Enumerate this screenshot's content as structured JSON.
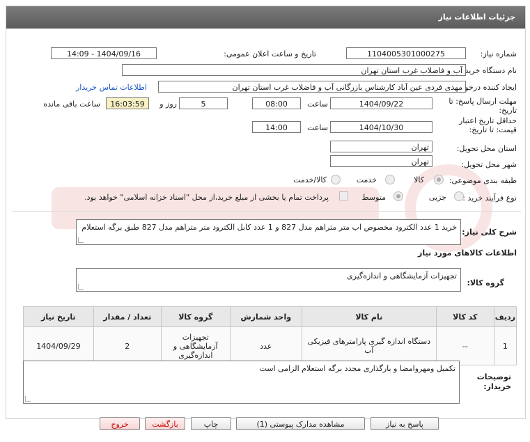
{
  "header": {
    "title": "جزئیات اطلاعات نیاز"
  },
  "fields": {
    "need_number_label": "شماره نیاز:",
    "need_number": "1104005301000275",
    "announce_label": "تاریخ و ساعت اعلان عمومی:",
    "announce_value": "1404/09/16 - 14:09",
    "buyer_org_label": "نام دستگاه خریدار:",
    "buyer_org": "آب و فاضلاب غرب استان تهران",
    "creator_label": "ایجاد کننده درخواست:",
    "creator": "مهدی فردی عین آباد کارشناس بازرگانی آب و فاضلاب غرب استان تهران",
    "contact_link": "اطلاعات تماس خریدار",
    "deadline_label_1": "مهلت ارسال پاسخ: تا",
    "deadline_label_2": "تاریخ:",
    "deadline_date": "1404/09/22",
    "time_label": "ساعت",
    "deadline_time": "08:00",
    "days_value": "5",
    "days_label": "روز و",
    "remaining_time": "16:03:59",
    "remaining_label": "ساعت باقی مانده",
    "validity_label_1": "حداقل تاریخ اعتبار",
    "validity_label_2": "قیمت: تا تاریخ:",
    "validity_date": "1404/10/30",
    "validity_time": "14:00",
    "province_label": "استان محل تحویل:",
    "province": "تهران",
    "city_label": "شهر محل تحویل:",
    "city": "تهران",
    "category_label": "طبقه بندی موضوعی:",
    "category_options": [
      "کالا",
      "خدمت",
      "کالا/خدمت"
    ],
    "process_label": "نوع فرآیند خرید :",
    "process_options": [
      "جزیی",
      "متوسط"
    ],
    "payment_note": "پرداخت تمام یا بخشی از مبلغ خرید،از محل \"اسناد خزانه اسلامی\" خواهد بود."
  },
  "description": {
    "label": "شرح کلی نیاز:",
    "text": "خرید 1 عدد الکترود مخصوص اب متر متراهم مدل 827 و 1 عدد کابل الکترود متر متراهم مدل 827 طبق برگه استعلام"
  },
  "goods_section": {
    "title": "اطلاعات کالاهای مورد نیاز",
    "group_label": "گروه کالا:",
    "group_value": "تجهیزات آزمایشگاهی و اندازه‌گیری"
  },
  "table": {
    "headers": [
      "ردیف",
      "کد کالا",
      "نام کالا",
      "واحد شمارش",
      "گروه کالا",
      "تعداد / مقدار",
      "تاریخ نیاز"
    ],
    "rows": [
      [
        "1",
        "--",
        "دستگاه اندازه گیری پارامترهای فیزیکی آب",
        "عدد",
        "تجهیزات آزمایشگاهی و اندازه‌گیری",
        "2",
        "1404/09/29"
      ]
    ]
  },
  "buyer_notes": {
    "label_1": "توضیحات",
    "label_2": "خریدار:",
    "text": "تکمیل ومهروامضا و بارگذاری مجدد برگه استعلام الزامی است"
  },
  "buttons": {
    "reply": "پاسخ به نیاز",
    "docs": "مشاهده مدارک پیوستی (1)",
    "print": "چاپ",
    "back": "بازگشت",
    "exit": "خروج"
  }
}
